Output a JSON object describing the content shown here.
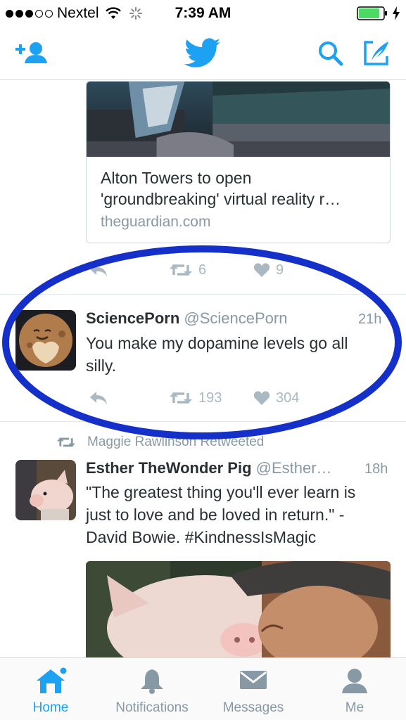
{
  "status_bar": {
    "carrier": "Nextel",
    "time": "7:39 AM",
    "signal_bars_filled": 3,
    "signal_bars_total": 5,
    "battery_level": 0.85
  },
  "nav": {
    "icons": [
      "add-user-icon",
      "twitter-bird-icon",
      "search-icon",
      "compose-icon"
    ]
  },
  "link_card": {
    "title_line1": "Alton Towers to open",
    "title_line2": "'groundbreaking' virtual reality r…",
    "domain": "theguardian.com"
  },
  "prev_tweet_actions": {
    "retweets": "6",
    "likes": "9"
  },
  "tweets": [
    {
      "name": "SciencePorn",
      "handle": "@SciencePorn",
      "time": "21h",
      "text_line1": "You make my dopamine levels go all",
      "text_line2": "silly.",
      "retweets": "193",
      "likes": "304"
    },
    {
      "retweeted_by": "Maggie Rawlinson Retweeted",
      "name": "Esther TheWonder Pig",
      "handle": "@Esther…",
      "time": "18h",
      "text_line1": "\"The greatest thing you'll ever learn is",
      "text_line2": "just to love and be loved in return.\" -",
      "text_line3": "David Bowie. #KindnessIsMagic"
    }
  ],
  "tab_bar": {
    "tabs": [
      {
        "label": "Home",
        "icon": "home-icon"
      },
      {
        "label": "Notifications",
        "icon": "bell-icon"
      },
      {
        "label": "Messages",
        "icon": "envelope-icon"
      },
      {
        "label": "Me",
        "icon": "person-icon"
      }
    ]
  },
  "colors": {
    "accent": "#1da1f2",
    "annotation": "#1530c8",
    "muted": "#8899a6",
    "battery": "#4cd964"
  }
}
